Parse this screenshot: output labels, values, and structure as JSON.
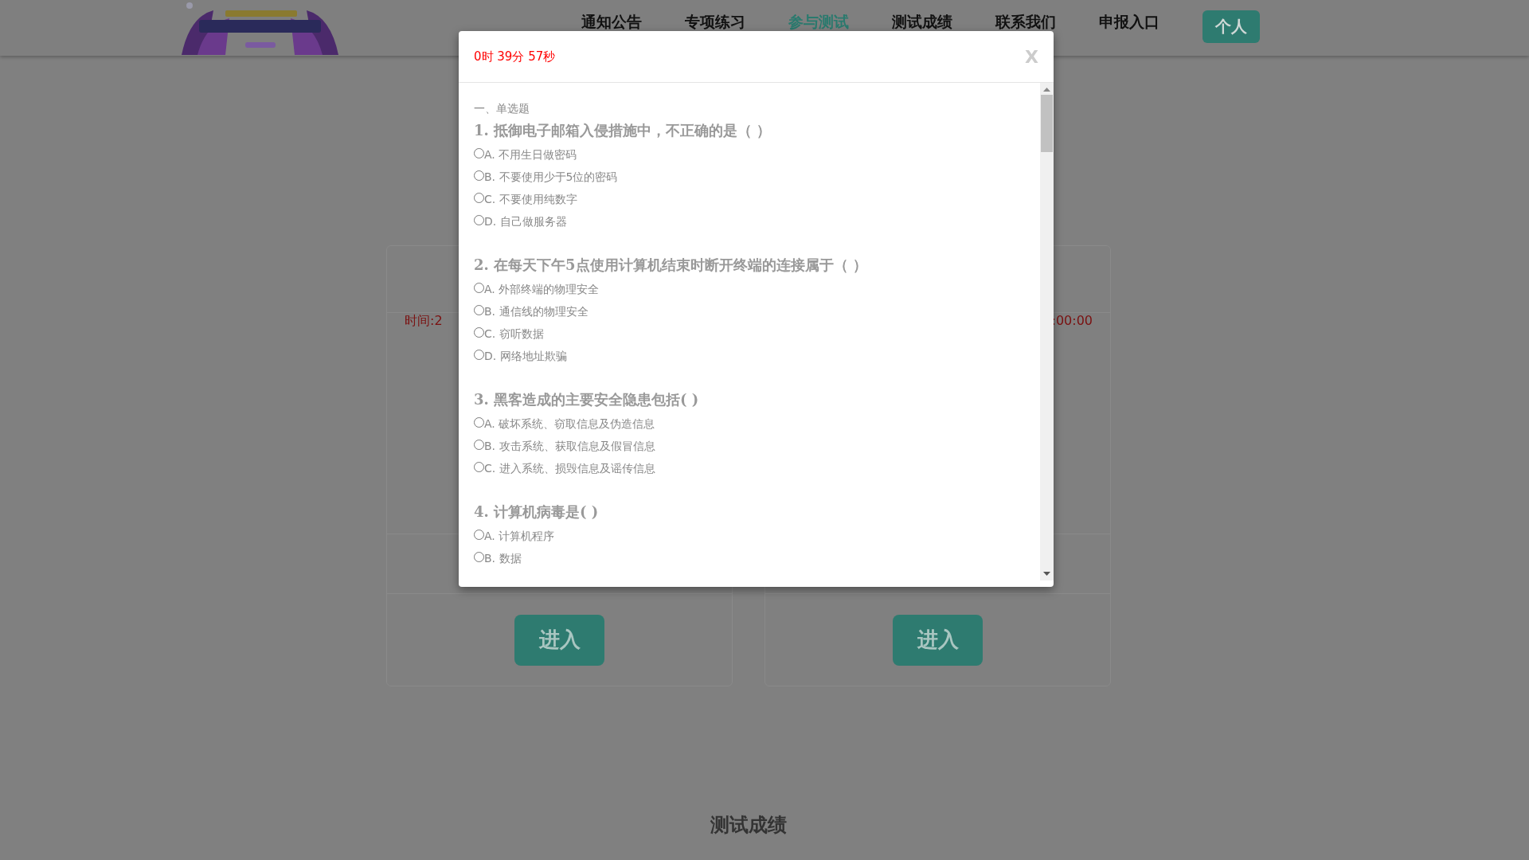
{
  "header": {
    "nav": [
      {
        "label": "通知公告",
        "selected": false
      },
      {
        "label": "专项练习",
        "selected": false
      },
      {
        "label": "参与测试",
        "selected": true
      },
      {
        "label": "测试成绩",
        "selected": false
      },
      {
        "label": "联系我们",
        "selected": false
      },
      {
        "label": "申报入口",
        "selected": false
      }
    ],
    "profile_button": "个人"
  },
  "cards": [
    {
      "time": "时间:2",
      "button": "进入"
    },
    {
      "time": ":00:00",
      "button": "进入"
    }
  ],
  "section_title": "测试成绩",
  "modal": {
    "timer": "0时 39分 57秒",
    "close": "X",
    "section": "一、单选题",
    "questions": [
      {
        "title": "1. 抵御电子邮箱入侵措施中，不正确的是（  ）",
        "options": [
          {
            "text": "A. 不用生日做密码",
            "selected": false
          },
          {
            "text": "B. 不要使用少于5位的密码",
            "selected": false
          },
          {
            "text": "C. 不要使用纯数字",
            "selected": false
          },
          {
            "text": "D. 自己做服务器",
            "selected": false
          }
        ]
      },
      {
        "title": "2. 在每天下午5点使用计算机结束时断开终端的连接属于（  ）",
        "options": [
          {
            "text": "A. 外部终端的物理安全",
            "selected": false
          },
          {
            "text": "B. 通信线的物理安全",
            "selected": false
          },
          {
            "text": "C. 窃听数据",
            "selected": false
          },
          {
            "text": "D. 网络地址欺骗",
            "selected": false
          }
        ]
      },
      {
        "title": "3. 黑客造成的主要安全隐患包括( )",
        "options": [
          {
            "text": "A. 破坏系统、窃取信息及伪造信息",
            "selected": false
          },
          {
            "text": "B. 攻击系统、获取信息及假冒信息",
            "selected": false
          },
          {
            "text": "C. 进入系统、损毁信息及谣传信息",
            "selected": false
          }
        ]
      },
      {
        "title": "4. 计算机病毒是( )",
        "options": [
          {
            "text": "A. 计算机程序",
            "selected": false
          },
          {
            "text": "B. 数据",
            "selected": false
          }
        ]
      }
    ]
  }
}
